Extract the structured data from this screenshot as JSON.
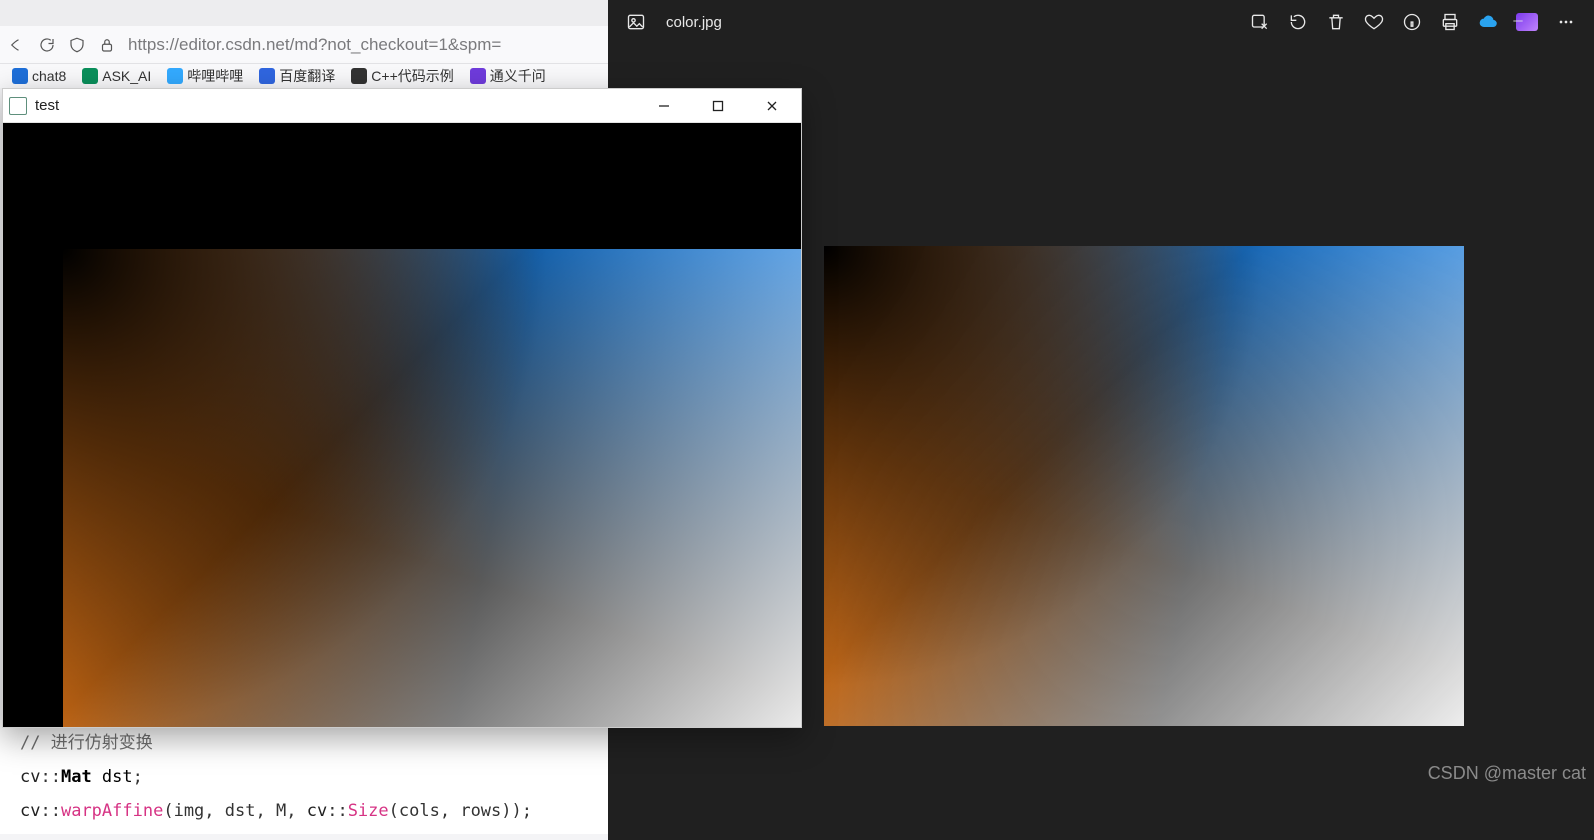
{
  "browser": {
    "url": "https://editor.csdn.net/md?not_checkout=1&spm=",
    "bookmarks": [
      {
        "label": "chat8",
        "color": "#1e6fd9"
      },
      {
        "label": "ASK_AI",
        "color": "#0a8f5b"
      },
      {
        "label": "哔哩哔哩",
        "color": "#33aaff"
      },
      {
        "label": "百度翻译",
        "color": "#3066e0"
      },
      {
        "label": "C++代码示例",
        "color": "#333333"
      },
      {
        "label": "通义千问",
        "color": "#6f3bdc"
      }
    ]
  },
  "code": {
    "comment": "// 进行仿射变换",
    "line1_tokens": [
      "cv",
      "::",
      "Mat",
      " dst",
      ";"
    ],
    "line2_tokens": [
      "cv",
      "::",
      "warpAffine",
      "(",
      "img",
      ", ",
      "dst",
      ", ",
      "M",
      ", ",
      "cv",
      "::",
      "Size",
      "(",
      "cols",
      ", ",
      "rows",
      ")",
      ")",
      ";"
    ]
  },
  "test_window": {
    "title": "test"
  },
  "photos": {
    "filename": "color.jpg",
    "toolbar_icons": [
      "edit-icon",
      "rotate-icon",
      "trash-icon",
      "heart-icon",
      "info-icon",
      "print-icon",
      "cloud-icon",
      "clipchamp-icon",
      "more-icon"
    ]
  },
  "watermark": "CSDN @master cat",
  "colors": {
    "blue": "#1678d8",
    "orange": "#e57817",
    "black": "#000000",
    "white": "#ffffff",
    "photos_bg": "#202020"
  }
}
